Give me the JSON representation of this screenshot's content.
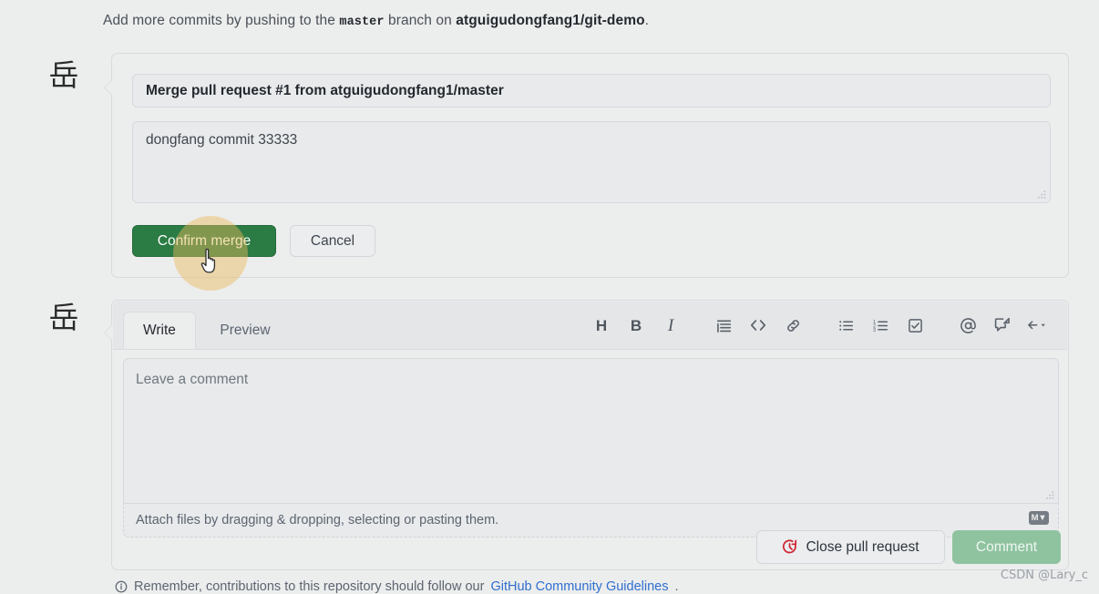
{
  "notice": {
    "prefix": "Add more commits by pushing to the ",
    "branch": "master",
    "middle": " branch on ",
    "repo": "atguigudongfang1/git-demo",
    "suffix": "."
  },
  "avatars": {
    "merge_glyph": "岳",
    "comment_glyph": "岳"
  },
  "merge_form": {
    "commit_title": "Merge pull request #1 from atguigudongfang1/master",
    "commit_description": "dongfang commit 33333",
    "confirm_label": "Confirm merge",
    "cancel_label": "Cancel"
  },
  "comment_form": {
    "tabs": [
      {
        "label": "Write",
        "active": true
      },
      {
        "label": "Preview",
        "active": false
      }
    ],
    "toolbar": [
      {
        "name": "heading-icon",
        "glyph": "H",
        "kind": "letter"
      },
      {
        "name": "bold-icon",
        "glyph": "B",
        "kind": "letter"
      },
      {
        "name": "italic-icon",
        "glyph": "I",
        "kind": "letter-italic"
      },
      {
        "name": "quote-icon",
        "glyph": "",
        "kind": "svg"
      },
      {
        "name": "code-icon",
        "glyph": "",
        "kind": "svg"
      },
      {
        "name": "link-icon",
        "glyph": "",
        "kind": "svg"
      },
      {
        "name": "unordered-list-icon",
        "glyph": "",
        "kind": "svg"
      },
      {
        "name": "ordered-list-icon",
        "glyph": "",
        "kind": "svg"
      },
      {
        "name": "task-list-icon",
        "glyph": "",
        "kind": "svg"
      },
      {
        "name": "mention-icon",
        "glyph": "",
        "kind": "svg"
      },
      {
        "name": "cross-reference-icon",
        "glyph": "",
        "kind": "svg"
      },
      {
        "name": "saved-replies-icon",
        "glyph": "",
        "kind": "svg"
      }
    ],
    "placeholder": "Leave a comment",
    "attach_hint": "Attach files by dragging & dropping, selecting or pasting them.",
    "markdown_badge": "M",
    "close_pr_label": "Close pull request",
    "comment_label": "Comment"
  },
  "bottom_note": {
    "text": "Remember, contributions to this repository should follow our ",
    "link": "GitHub Community Guidelines",
    "suffix": "."
  },
  "watermark": "CSDN @Lary_c",
  "colors": {
    "page_bg": "#eceded",
    "merge_green": "#2a7b44",
    "comment_disabled_green": "#8fc3a0",
    "close_pr_red": "#cf222e",
    "link_blue": "#2f6fd0",
    "highlight_amber": "rgba(235,186,92,.45)"
  }
}
